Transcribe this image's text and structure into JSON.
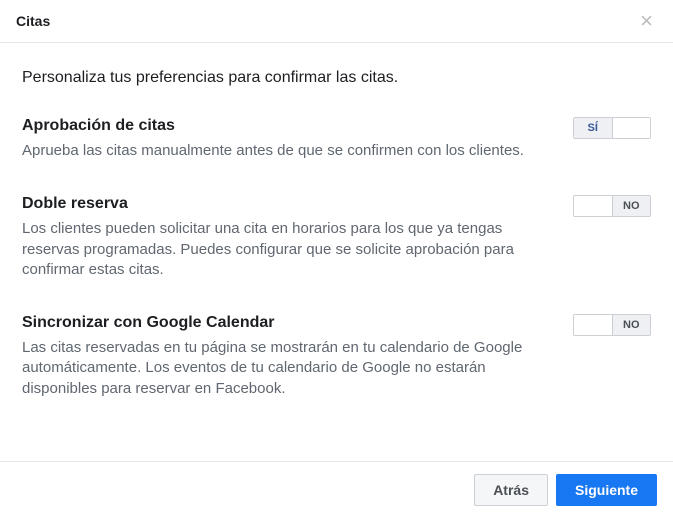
{
  "header": {
    "title": "Citas"
  },
  "intro": "Personaliza tus preferencias para confirmar las citas.",
  "settings": {
    "approval": {
      "title": "Aprobación de citas",
      "desc": "Aprueba las citas manualmente antes de que se confirmen con los clientes.",
      "value": "SÍ",
      "on": true
    },
    "double": {
      "title": "Doble reserva",
      "desc": "Los clientes pueden solicitar una cita en horarios para los que ya tengas reservas programadas. Puedes configurar que se solicite aprobación para confirmar estas citas.",
      "value": "NO",
      "on": false
    },
    "sync": {
      "title": "Sincronizar con Google Calendar",
      "desc": "Las citas reservadas en tu página se mostrarán en tu calendario de Google automáticamente. Los eventos de tu calendario de Google no estarán disponibles para reservar en Facebook.",
      "value": "NO",
      "on": false
    }
  },
  "toggle_labels": {
    "yes": "SÍ",
    "no": "NO"
  },
  "footer": {
    "back": "Atrás",
    "next": "Siguiente"
  }
}
